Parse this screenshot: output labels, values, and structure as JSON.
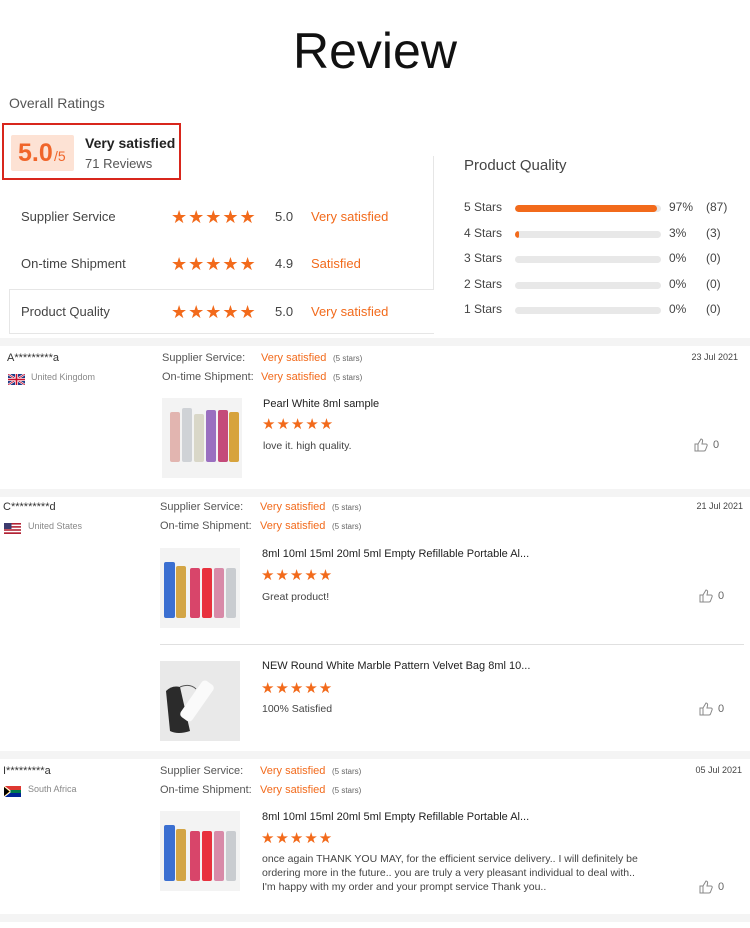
{
  "page_title": "Review",
  "overall": {
    "label": "Overall Ratings",
    "score": "5.0",
    "score_den": "/5",
    "verdict": "Very satisfied",
    "review_count": "71 Reviews"
  },
  "ratings": [
    {
      "label": "Supplier Service",
      "stars": "★★★★★",
      "score": "5.0",
      "verdict": "Very satisfied"
    },
    {
      "label": "On-time Shipment",
      "stars": "★★★★★",
      "score": "4.9",
      "verdict": "Satisfied"
    },
    {
      "label": "Product Quality",
      "stars": "★★★★★",
      "score": "5.0",
      "verdict": "Very satisfied"
    }
  ],
  "product_quality": {
    "title": "Product Quality",
    "rows": [
      {
        "label": "5  Stars",
        "fraction": 0.97,
        "pct": "97%",
        "count": "(87)"
      },
      {
        "label": "4  Stars",
        "fraction": 0.03,
        "pct": "3%",
        "count": "(3)"
      },
      {
        "label": "3  Stars",
        "fraction": 0.0,
        "pct": "0%",
        "count": "(0)"
      },
      {
        "label": "2  Stars",
        "fraction": 0.0,
        "pct": "0%",
        "count": "(0)"
      },
      {
        "label": "1  Stars",
        "fraction": 0.0,
        "pct": "0%",
        "count": "(0)"
      }
    ]
  },
  "reviews": [
    {
      "name": "A*********a",
      "country": "United Kingdom",
      "flag": "gb",
      "date": "23 Jul 2021",
      "supplier_label": "Supplier Service:",
      "supplier_val": "Very satisfied",
      "supplier_stars": "(5 stars)",
      "shipment_label": "On-time Shipment:",
      "shipment_val": "Very satisfied",
      "shipment_stars": "(5 stars)",
      "items": [
        {
          "name": "Pearl White 8ml sample",
          "stars": "★★★★★",
          "text": "love it. high quality.",
          "likes": "0"
        }
      ]
    },
    {
      "name": "C*********d",
      "country": "United States",
      "flag": "us",
      "date": "21 Jul 2021",
      "supplier_label": "Supplier Service:",
      "supplier_val": "Very satisfied",
      "supplier_stars": "(5 stars)",
      "shipment_label": "On-time Shipment:",
      "shipment_val": "Very satisfied",
      "shipment_stars": "(5 stars)",
      "items": [
        {
          "name": "8ml 10ml 15ml 20ml 5ml Empty Refillable Portable Al...",
          "stars": "★★★★★",
          "text": "Great product!",
          "likes": "0"
        },
        {
          "name": "NEW Round White Marble Pattern Velvet Bag 8ml 10...",
          "stars": "★★★★★",
          "text": "100% Satisfied",
          "likes": "0"
        }
      ]
    },
    {
      "name": "I*********a",
      "country": "South Africa",
      "flag": "za",
      "date": "05 Jul 2021",
      "supplier_label": "Supplier Service:",
      "supplier_val": "Very satisfied",
      "supplier_stars": "(5 stars)",
      "shipment_label": "On-time Shipment:",
      "shipment_val": "Very satisfied",
      "shipment_stars": "(5 stars)",
      "items": [
        {
          "name": "8ml 10ml 15ml 20ml 5ml Empty Refillable Portable Al...",
          "stars": "★★★★★",
          "text_lines": [
            "once again THANK YOU MAY, for the efficient service delivery..  I will definitely be",
            "ordering more in the future.. you are truly a very pleasant individual to deal with..",
            "I'm happy with my order and your prompt service Thank you.."
          ],
          "likes": "0"
        }
      ]
    }
  ]
}
